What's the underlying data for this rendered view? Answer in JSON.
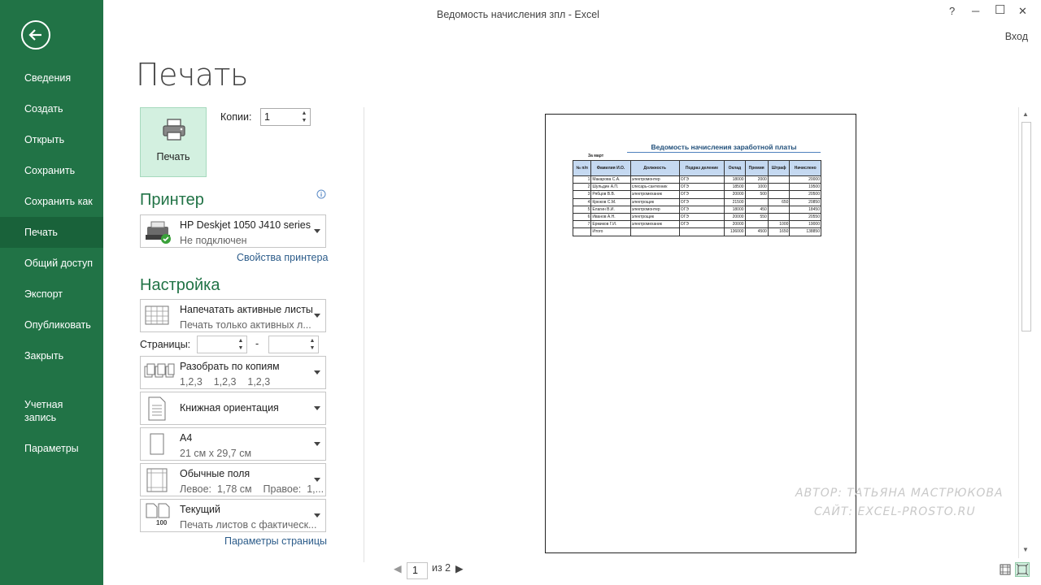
{
  "window": {
    "title": "Ведомость начисления зпл - Excel",
    "help": "?",
    "minimize": "─",
    "maximize": "☐",
    "close": "✕",
    "signin": "Вход"
  },
  "sidebar": {
    "items": [
      {
        "label": "Сведения"
      },
      {
        "label": "Создать"
      },
      {
        "label": "Открыть"
      },
      {
        "label": "Сохранить"
      },
      {
        "label": "Сохранить как"
      },
      {
        "label": "Печать"
      },
      {
        "label": "Общий доступ"
      },
      {
        "label": "Экспорт"
      },
      {
        "label": "Опубликовать"
      },
      {
        "label": "Закрыть"
      },
      {
        "label": "Учетная запись"
      },
      {
        "label": "Параметры"
      }
    ],
    "active": "Печать"
  },
  "print": {
    "page_title": "Печать",
    "print_button": "Печать",
    "copies_label": "Копии:",
    "copies_value": "1"
  },
  "printer": {
    "heading": "Принтер",
    "name": "HP Deskjet 1050 J410 series",
    "status": "Не подключен",
    "properties_link": "Свойства принтера"
  },
  "settings": {
    "heading": "Настройка",
    "what": {
      "l1": "Напечатать активные листы",
      "l2": "Печать только активных л..."
    },
    "pages_label": "Страницы:",
    "pages_sep": "-",
    "collate": {
      "l1": "Разобрать по копиям",
      "l2": "1,2,3    1,2,3    1,2,3"
    },
    "orientation": {
      "l1": "Книжная ориентация"
    },
    "paper": {
      "l1": "А4",
      "l2": "21 см x 29,7 см"
    },
    "margins": {
      "l1": "Обычные поля",
      "l2": "Левое:  1,78 см    Правое:  1,..."
    },
    "scaling": {
      "l1": "Текущий",
      "l2": "Печать листов с фактическ...",
      "icon_text": "100"
    },
    "page_setup_link": "Параметры страницы"
  },
  "preview": {
    "sheet_title": "Ведомость начисления заработной платы",
    "period": "За март",
    "headers": [
      "№ п/п",
      "Фамилия И.О.",
      "Должность",
      "Подраз деление",
      "Оклад",
      "Премия",
      "Штраф",
      "Начислено"
    ],
    "rows": [
      [
        "1",
        "Макарова С.А.",
        "электромонтер",
        "ОГЭ",
        "18000",
        "2000",
        "",
        "20000"
      ],
      [
        "2",
        "Шульдин А.П.",
        "слесарь-сантехник",
        "ОГЭ",
        "18500",
        "1000",
        "",
        "19500"
      ],
      [
        "3",
        "Рябцов В.В.",
        "электромеханик",
        "ОГЭ",
        "20000",
        "500",
        "",
        "20500"
      ],
      [
        "4",
        "Крюков С.М.",
        "электрощик",
        "ОГЭ",
        "21500",
        "",
        "650",
        "20850"
      ],
      [
        "5",
        "Елагин В.И.",
        "электромонтер",
        "ОГЭ",
        "18000",
        "450",
        "",
        "18450"
      ],
      [
        "6",
        "Иванов А.Н.",
        "электрощик",
        "ОГЭ",
        "20000",
        "550",
        "",
        "20550"
      ],
      [
        "7",
        "Ермиков Г.И.",
        "электромеханик",
        "ОГЭ",
        "20000",
        "",
        "1000",
        "19000"
      ],
      [
        "",
        "Итого",
        "",
        "",
        "136000",
        "4500",
        "1650",
        "138850"
      ]
    ],
    "current_page": "1",
    "of_pages": "из 2"
  },
  "watermark": {
    "line1": "АВТОР: ТАТЬЯНА МАСТРЮКОВА",
    "line2": "САЙТ: EXCEL-PROSTO.RU"
  },
  "colors": {
    "accent": "#217346",
    "active": "#19623a",
    "link": "#2c5c8a"
  }
}
